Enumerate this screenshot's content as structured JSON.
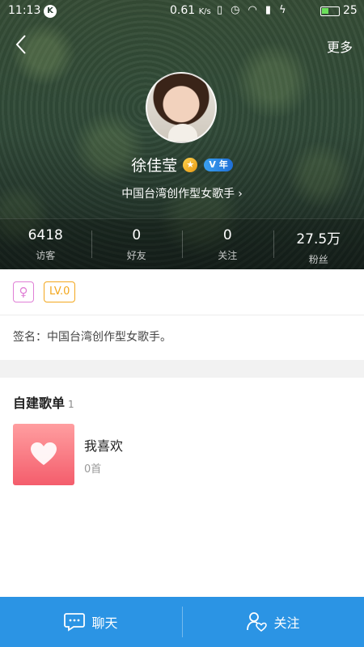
{
  "status_bar": {
    "time": "11:13",
    "app_icon_letter": "K",
    "speed_value": "0.61",
    "speed_unit": "K/s",
    "battery": "25"
  },
  "header": {
    "more_label": "更多",
    "name": "徐佳莹",
    "crown_badge_symbol": "★",
    "v_badge_label": "V 年",
    "title": "中国台湾创作型女歌手",
    "chevron": "›"
  },
  "stats": [
    {
      "value": "6418",
      "label": "访客"
    },
    {
      "value": "0",
      "label": "好友"
    },
    {
      "value": "0",
      "label": "关注"
    },
    {
      "value": "27.5万",
      "label": "粉丝"
    }
  ],
  "badges": {
    "gender_symbol": "♀",
    "level": "LV.0"
  },
  "signature": "签名：中国台湾创作型女歌手。",
  "playlists_section": {
    "title": "自建歌单",
    "count": "1",
    "items": [
      {
        "name": "我喜欢",
        "count": "0首"
      }
    ]
  },
  "bottom_bar": {
    "chat_label": "聊天",
    "follow_label": "关注"
  }
}
